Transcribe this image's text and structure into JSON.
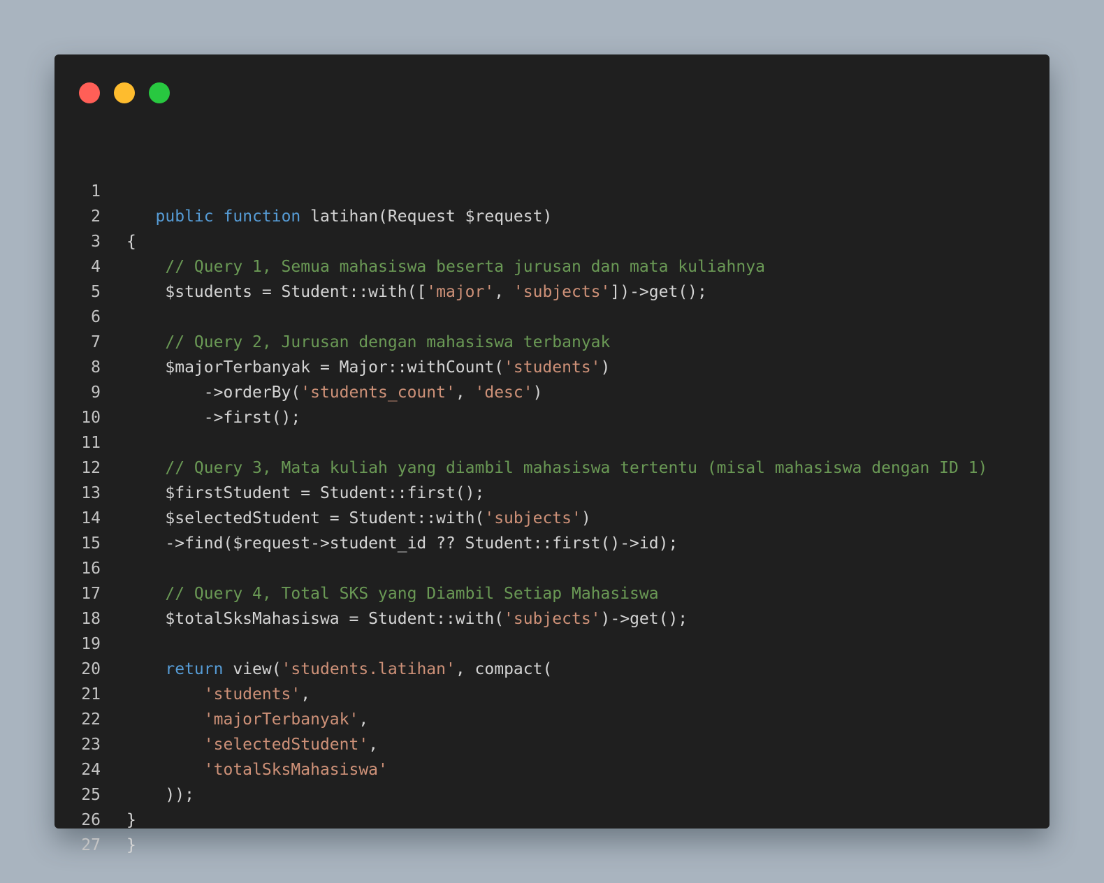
{
  "window": {
    "buttons": {
      "close_color": "#ff5f57",
      "minimize_color": "#febc2e",
      "maximize_color": "#28c840"
    }
  },
  "code": {
    "lines": [
      {
        "n": "1",
        "tokens": []
      },
      {
        "n": "2",
        "tokens": [
          {
            "t": "   ",
            "c": ""
          },
          {
            "t": "public",
            "c": "kw"
          },
          {
            "t": " ",
            "c": ""
          },
          {
            "t": "function",
            "c": "kw"
          },
          {
            "t": " latihan(Request $request)",
            "c": ""
          }
        ]
      },
      {
        "n": "3",
        "tokens": [
          {
            "t": "{",
            "c": ""
          }
        ]
      },
      {
        "n": "4",
        "tokens": [
          {
            "t": "    ",
            "c": ""
          },
          {
            "t": "// Query 1, Semua mahasiswa beserta jurusan dan mata kuliahnya",
            "c": "cm"
          }
        ]
      },
      {
        "n": "5",
        "tokens": [
          {
            "t": "    $students = Student::with([",
            "c": ""
          },
          {
            "t": "'major'",
            "c": "str"
          },
          {
            "t": ", ",
            "c": ""
          },
          {
            "t": "'subjects'",
            "c": "str"
          },
          {
            "t": "])->get();",
            "c": ""
          }
        ]
      },
      {
        "n": "6",
        "tokens": []
      },
      {
        "n": "7",
        "tokens": [
          {
            "t": "    ",
            "c": ""
          },
          {
            "t": "// Query 2, Jurusan dengan mahasiswa terbanyak",
            "c": "cm"
          }
        ]
      },
      {
        "n": "8",
        "tokens": [
          {
            "t": "    $majorTerbanyak = Major::withCount(",
            "c": ""
          },
          {
            "t": "'students'",
            "c": "str"
          },
          {
            "t": ")",
            "c": ""
          }
        ]
      },
      {
        "n": "9",
        "tokens": [
          {
            "t": "        ->orderBy(",
            "c": ""
          },
          {
            "t": "'students_count'",
            "c": "str"
          },
          {
            "t": ", ",
            "c": ""
          },
          {
            "t": "'desc'",
            "c": "str"
          },
          {
            "t": ")",
            "c": ""
          }
        ]
      },
      {
        "n": "10",
        "tokens": [
          {
            "t": "        ->first();",
            "c": ""
          }
        ]
      },
      {
        "n": "11",
        "tokens": []
      },
      {
        "n": "12",
        "tokens": [
          {
            "t": "    ",
            "c": ""
          },
          {
            "t": "// Query 3, Mata kuliah yang diambil mahasiswa tertentu (misal mahasiswa dengan ID 1)",
            "c": "cm"
          }
        ]
      },
      {
        "n": "13",
        "tokens": [
          {
            "t": "    $firstStudent = Student::first();",
            "c": ""
          }
        ]
      },
      {
        "n": "14",
        "tokens": [
          {
            "t": "    $selectedStudent = Student::with(",
            "c": ""
          },
          {
            "t": "'subjects'",
            "c": "str"
          },
          {
            "t": ")",
            "c": ""
          }
        ]
      },
      {
        "n": "15",
        "tokens": [
          {
            "t": "    ->find($request->student_id ?? Student::first()->id);",
            "c": ""
          }
        ]
      },
      {
        "n": "16",
        "tokens": []
      },
      {
        "n": "17",
        "tokens": [
          {
            "t": "    ",
            "c": ""
          },
          {
            "t": "// Query 4, Total SKS yang Diambil Setiap Mahasiswa",
            "c": "cm"
          }
        ]
      },
      {
        "n": "18",
        "tokens": [
          {
            "t": "    $totalSksMahasiswa = Student::with(",
            "c": ""
          },
          {
            "t": "'subjects'",
            "c": "str"
          },
          {
            "t": ")->get();",
            "c": ""
          }
        ]
      },
      {
        "n": "19",
        "tokens": []
      },
      {
        "n": "20",
        "tokens": [
          {
            "t": "    ",
            "c": ""
          },
          {
            "t": "return",
            "c": "kw"
          },
          {
            "t": " view(",
            "c": ""
          },
          {
            "t": "'students.latihan'",
            "c": "str"
          },
          {
            "t": ", compact(",
            "c": ""
          }
        ]
      },
      {
        "n": "21",
        "tokens": [
          {
            "t": "        ",
            "c": ""
          },
          {
            "t": "'students'",
            "c": "str"
          },
          {
            "t": ",",
            "c": ""
          }
        ]
      },
      {
        "n": "22",
        "tokens": [
          {
            "t": "        ",
            "c": ""
          },
          {
            "t": "'majorTerbanyak'",
            "c": "str"
          },
          {
            "t": ",",
            "c": ""
          }
        ]
      },
      {
        "n": "23",
        "tokens": [
          {
            "t": "        ",
            "c": ""
          },
          {
            "t": "'selectedStudent'",
            "c": "str"
          },
          {
            "t": ",",
            "c": ""
          }
        ]
      },
      {
        "n": "24",
        "tokens": [
          {
            "t": "        ",
            "c": ""
          },
          {
            "t": "'totalSksMahasiswa'",
            "c": "str"
          }
        ]
      },
      {
        "n": "25",
        "tokens": [
          {
            "t": "    ));",
            "c": ""
          }
        ]
      },
      {
        "n": "26",
        "tokens": [
          {
            "t": "}",
            "c": ""
          }
        ]
      },
      {
        "n": "27",
        "tokens": [
          {
            "t": "}",
            "c": ""
          }
        ]
      }
    ]
  }
}
